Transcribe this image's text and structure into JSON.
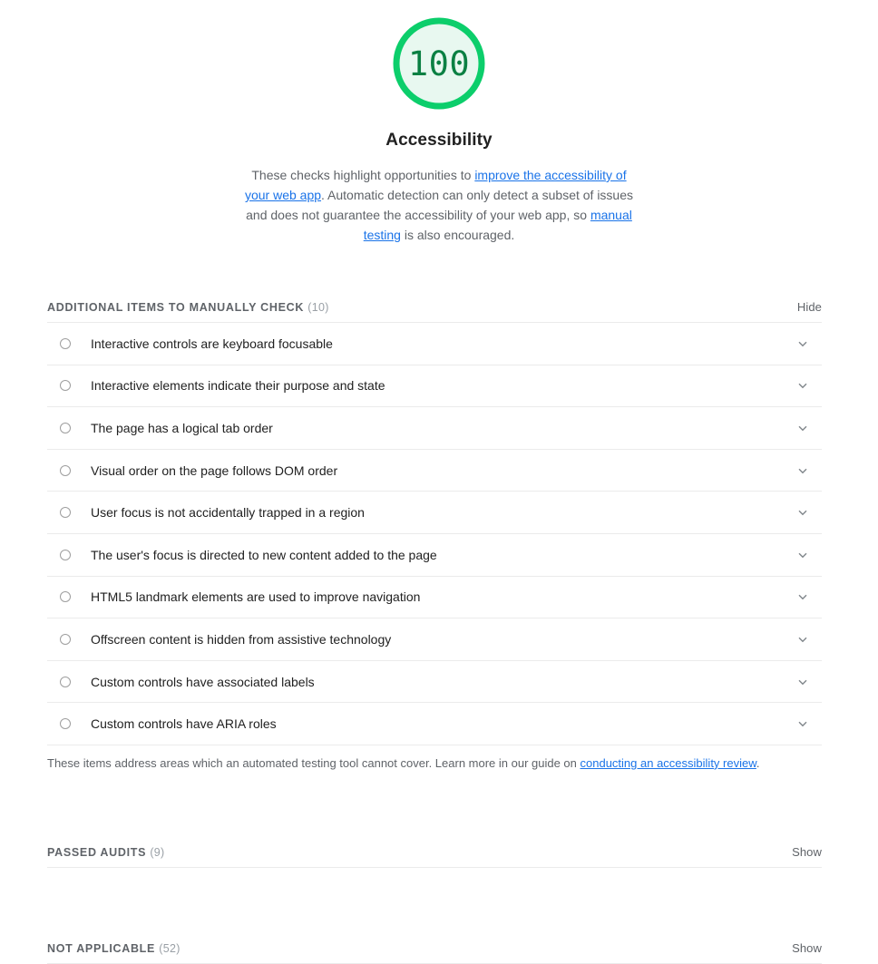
{
  "score": {
    "value": "100",
    "category_title": "Accessibility",
    "ring_color": "#0cce6b",
    "fill_color": "#e8f8f0",
    "text_color": "#0b8043"
  },
  "description": {
    "part1": "These checks highlight opportunities to ",
    "link1": "improve the accessibility of your web app",
    "part2": ". Automatic detection can only detect a subset of issues and does not guarantee the accessibility of your web app, so ",
    "link2": "manual testing",
    "part3": " is also encouraged."
  },
  "manual_clump": {
    "title": "ADDITIONAL ITEMS TO MANUALLY CHECK",
    "count": "(10)",
    "toggle_label": "Hide",
    "items": [
      {
        "label": "Interactive controls are keyboard focusable"
      },
      {
        "label": "Interactive elements indicate their purpose and state"
      },
      {
        "label": "The page has a logical tab order"
      },
      {
        "label": "Visual order on the page follows DOM order"
      },
      {
        "label": "User focus is not accidentally trapped in a region"
      },
      {
        "label": "The user's focus is directed to new content added to the page"
      },
      {
        "label": "HTML5 landmark elements are used to improve navigation"
      },
      {
        "label": "Offscreen content is hidden from assistive technology"
      },
      {
        "label": "Custom controls have associated labels"
      },
      {
        "label": "Custom controls have ARIA roles"
      }
    ],
    "footer_text": "These items address areas which an automated testing tool cannot cover. Learn more in our guide on ",
    "footer_link": "conducting an accessibility review",
    "footer_end": "."
  },
  "passed_clump": {
    "title": "PASSED AUDITS",
    "count": "(9)",
    "toggle_label": "Show"
  },
  "not_applicable_clump": {
    "title": "NOT APPLICABLE",
    "count": "(52)",
    "toggle_label": "Show"
  },
  "icons": {
    "bullet": "circle-outline-icon",
    "expand": "chevron-down-icon"
  }
}
